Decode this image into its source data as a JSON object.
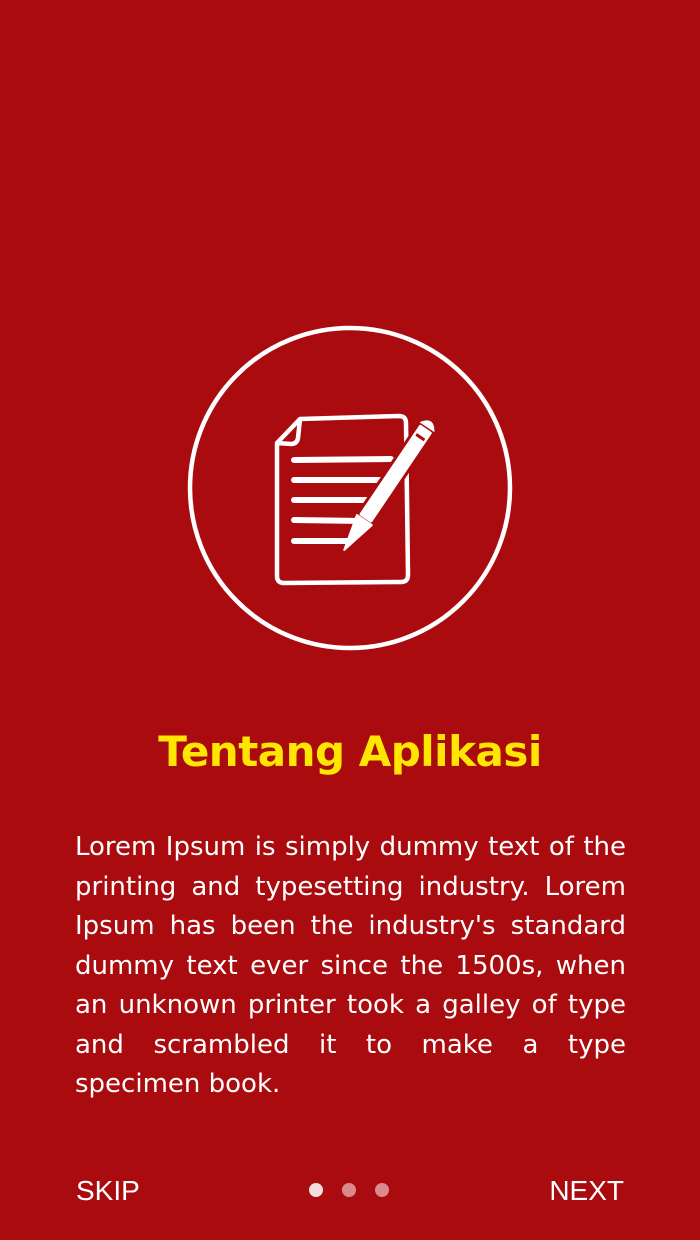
{
  "colors": {
    "background": "#a90b0e",
    "title": "#ffe600",
    "text": "#ffffff",
    "dot_active": "#f4dcdc",
    "dot_inactive": "#d98a8c"
  },
  "illustration": {
    "icon": "document-pen-icon"
  },
  "onboarding": {
    "title": "Tentang Aplikasi",
    "description": "Lorem Ipsum is simply dummy text of the printing and typesetting industry. Lorem Ipsum has been the industry's standard dummy text ever since the 1500s, when an unknown printer took a galley of type and scrambled it to make a type specimen book."
  },
  "nav": {
    "skip_label": "SKIP",
    "next_label": "NEXT",
    "page_count": 3,
    "current_page": 1
  }
}
